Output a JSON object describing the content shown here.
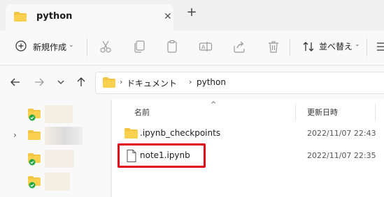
{
  "tab": {
    "title": "python",
    "close_icon": "close-icon",
    "new_tab_icon": "plus-icon"
  },
  "toolbar": {
    "new_label": "新規作成",
    "sort_label": "並べ替え",
    "icons": [
      "cut-icon",
      "copy-icon",
      "paste-icon",
      "rename-icon",
      "share-icon",
      "delete-icon"
    ]
  },
  "navigation": {
    "back_icon": "arrow-left-icon",
    "forward_icon": "arrow-right-icon",
    "recent_icon": "chevron-down-icon",
    "up_icon": "arrow-up-icon"
  },
  "address": {
    "separator": "›",
    "segments": [
      "ドキュメント",
      "python"
    ]
  },
  "columns": {
    "name": "名前",
    "date": "更新日時",
    "sort_indicator": "^"
  },
  "files": [
    {
      "name": ".ipynb_checkpoints",
      "date": "2022/11/07 22:43",
      "icon": "folder-icon"
    },
    {
      "name": "note1.ipynb",
      "date": "2022/11/07 22:35",
      "icon": "file-icon",
      "highlighted": true
    }
  ],
  "colors": {
    "highlight": "#e3001b",
    "folder": "#f4c542",
    "sync_check": "#22a745"
  }
}
